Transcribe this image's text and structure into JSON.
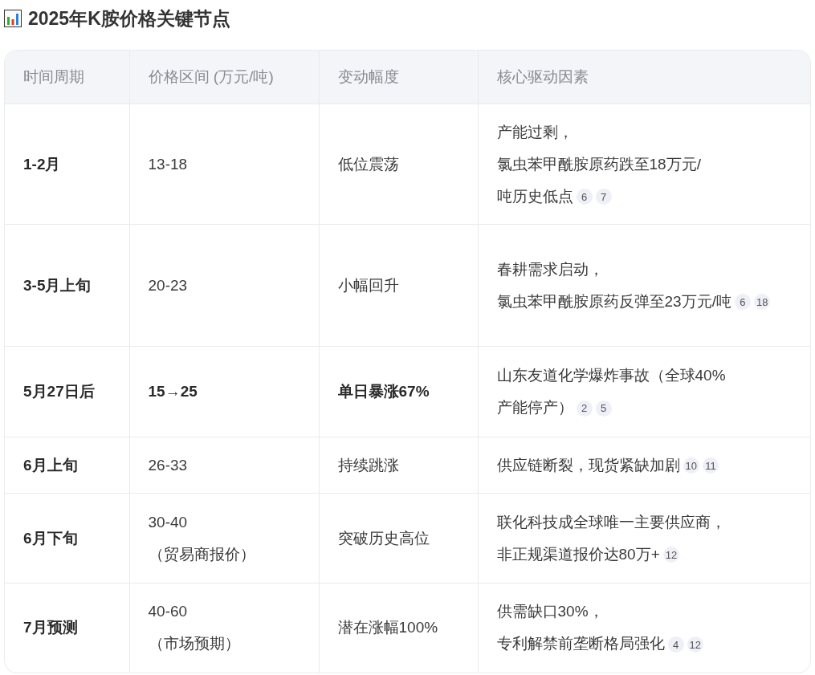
{
  "title": "2025年K胺价格关键节点",
  "table": {
    "columns": [
      "时间周期",
      "价格区间 (万元/吨)",
      "变动幅度",
      "核心驱动因素"
    ],
    "rows": [
      {
        "period": {
          "lines": [
            "1-2月"
          ],
          "bold": true
        },
        "price": {
          "lines": [
            "13-18"
          ],
          "bold": false
        },
        "change": {
          "lines": [
            "低位震荡"
          ],
          "bold": false
        },
        "driver": {
          "lines": [
            "产能过剩，",
            "氯虫苯甲酰胺原药跌至18万元/",
            "吨历史低点"
          ],
          "refs": [
            "6",
            "7"
          ]
        }
      },
      {
        "period": {
          "lines": [
            "3-5月上旬"
          ],
          "bold": true
        },
        "price": {
          "lines": [
            "20-23"
          ],
          "bold": false
        },
        "change": {
          "lines": [
            "小幅回升"
          ],
          "bold": false
        },
        "driver": {
          "lines": [
            "春耕需求启动，",
            "氯虫苯甲酰胺原药反弹至23万元/吨"
          ],
          "refs": [
            "6",
            "18"
          ]
        }
      },
      {
        "period": {
          "lines": [
            "5月27日后"
          ],
          "bold": true
        },
        "price": {
          "lines": [
            "15→25"
          ],
          "bold": true
        },
        "change": {
          "lines": [
            "单日暴涨67%"
          ],
          "bold": true
        },
        "driver": {
          "lines": [
            "山东友道化学爆炸事故（全球40%",
            "产能停产）"
          ],
          "refs": [
            "2",
            "5"
          ]
        }
      },
      {
        "period": {
          "lines": [
            "6月上旬"
          ],
          "bold": true
        },
        "price": {
          "lines": [
            "26-33"
          ],
          "bold": false
        },
        "change": {
          "lines": [
            "持续跳涨"
          ],
          "bold": false
        },
        "driver": {
          "lines": [
            "供应链断裂，现货紧缺加剧"
          ],
          "refs": [
            "10",
            "11"
          ]
        }
      },
      {
        "period": {
          "lines": [
            "6月下旬"
          ],
          "bold": true
        },
        "price": {
          "lines": [
            "30-40",
            "（贸易商报价）"
          ],
          "bold": false
        },
        "change": {
          "lines": [
            "突破历史高位"
          ],
          "bold": false
        },
        "driver": {
          "lines": [
            "联化科技成全球唯一主要供应商，",
            "非正规渠道报价达80万+"
          ],
          "refs": [
            "12"
          ]
        }
      },
      {
        "period": {
          "lines": [
            "7月预测"
          ],
          "bold": true
        },
        "price": {
          "lines": [
            "40-60",
            "（市场预期）"
          ],
          "bold": false
        },
        "change": {
          "lines": [
            "潜在涨幅100%"
          ],
          "bold": false
        },
        "driver": {
          "lines": [
            "供需缺口30%，",
            "专利解禁前垄断格局强化"
          ],
          "refs": [
            "4",
            "12"
          ]
        }
      }
    ]
  }
}
